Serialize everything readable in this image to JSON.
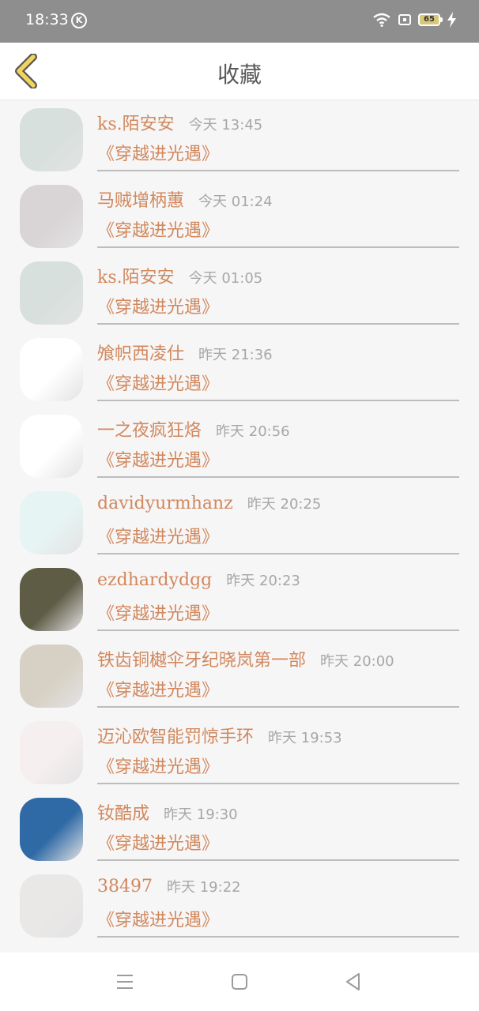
{
  "status_bar": {
    "time": "18:33",
    "k_badge": "K",
    "battery": "65"
  },
  "header": {
    "title": "收藏",
    "back_icon": "chevron-left-icon"
  },
  "items": [
    {
      "name": "ks.陌安安",
      "time": "今天 13:45",
      "title": "《穿越进光遇》",
      "avatar_color": "#d7e0dd"
    },
    {
      "name": "马贼增柄蕙",
      "time": "今天 01:24",
      "title": "《穿越进光遇》",
      "avatar_color": "#d9d4d5"
    },
    {
      "name": "ks.陌安安",
      "time": "今天 01:05",
      "title": "《穿越进光遇》",
      "avatar_color": "#d7e0dd"
    },
    {
      "name": "飧帜西凌仕",
      "time": "昨天 21:36",
      "title": "《穿越进光遇》",
      "avatar_color": "#ffffff"
    },
    {
      "name": "一之夜疯狂烙",
      "time": "昨天 20:56",
      "title": "《穿越进光遇》",
      "avatar_color": "#ffffff"
    },
    {
      "name": "davidyurmhanz",
      "time": "昨天 20:25",
      "title": "《穿越进光遇》",
      "avatar_color": "#e6f4f3"
    },
    {
      "name": "ezdhardydgg",
      "time": "昨天 20:23",
      "title": "《穿越进光遇》",
      "avatar_color": "#5f5c46"
    },
    {
      "name": "铁齿铜樾伞牙纪晓岚第一部",
      "time": "昨天 20:00",
      "title": "《穿越进光遇》",
      "avatar_color": "#d6d1c4"
    },
    {
      "name": "迈沁欧智能罚惊手环",
      "time": "昨天 19:53",
      "title": "《穿越进光遇》",
      "avatar_color": "#f5efef"
    },
    {
      "name": "钕酷成",
      "time": "昨天 19:30",
      "title": "《穿越进光遇》",
      "avatar_color": "#2f6aa6"
    },
    {
      "name": "38497",
      "time": "昨天 19:22",
      "title": "《穿越进光遇》",
      "avatar_color": "#eae8e7"
    }
  ],
  "nav": {
    "menu_icon": "menu-icon",
    "home_icon": "square-icon",
    "back_icon": "triangle-back-icon"
  }
}
